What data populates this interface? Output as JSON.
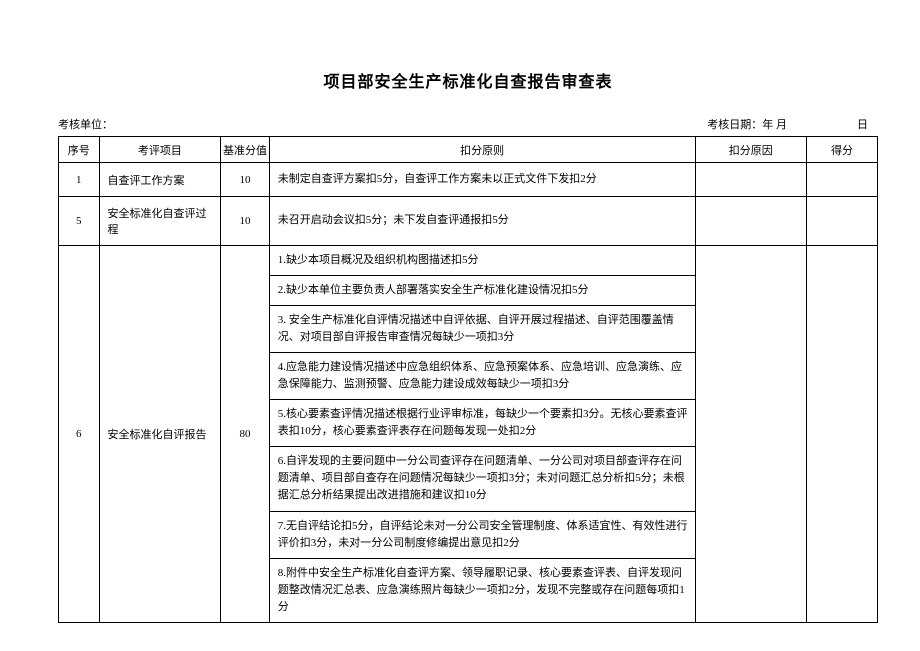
{
  "title": "项目部安全生产标准化自查报告审查表",
  "meta": {
    "unit_label": "考核单位：",
    "date_label": "考核日期：",
    "ym": "年 月",
    "day": "日"
  },
  "headers": {
    "seq": "序号",
    "item": "考评项目",
    "base": "基准分值",
    "rule": "扣分原则",
    "reason": "扣分原因",
    "score": "得分"
  },
  "rows": [
    {
      "seq": "1",
      "item": "自查评工作方案",
      "base": "10",
      "rule": "未制定自查评方案扣5分，自查评工作方案未以正式文件下发扣2分",
      "reason": "",
      "score": ""
    },
    {
      "seq": "5",
      "item": "安全标准化自查评过程",
      "base": "10",
      "rule": "未召开启动会议扣5分；未下发自查评通报扣5分",
      "reason": "",
      "score": ""
    },
    {
      "seq": "6",
      "item": "安全标准化自评报告",
      "base": "80",
      "rules": [
        "1.缺少本项目概况及组织机构图描述扣5分",
        "2.缺少本单位主要负责人部署落实安全生产标准化建设情况扣5分",
        "3. 安全生产标准化自评情况描述中自评依据、自评开展过程描述、自评范围覆盖情况、对项目部自评报告审查情况每缺少一项扣3分",
        "4.应急能力建设情况描述中应急组织体系、应急预案体系、应急培训、应急演练、应急保障能力、监测预警、应急能力建设成效每缺少一项扣3分",
        "5.核心要素查评情况描述根据行业评审标准，每缺少一个要素扣3分。无核心要素查评表扣10分，核心要素查评表存在问题每发现一处扣2分",
        "6.自评发现的主要问题中一分公司查评存在问题清单、一分公司对项目部查评存在问题清单、项目部自查存在问题情况每缺少一项扣3分；未对问题汇总分析扣5分；未根据汇总分析结果提出改进措施和建议扣10分",
        "7.无自评结论扣5分，自评结论未对一分公司安全管理制度、体系适宜性、有效性进行评价扣3分，未对一分公司制度修编提出意见扣2分",
        "8.附件中安全生产标准化自查评方案、领导履职记录、核心要素查评表、自评发现问题整改情况汇总表、应急演练照片每缺少一项扣2分，发现不完整或存在问题每项扣1分"
      ],
      "reason": "",
      "score": ""
    }
  ]
}
